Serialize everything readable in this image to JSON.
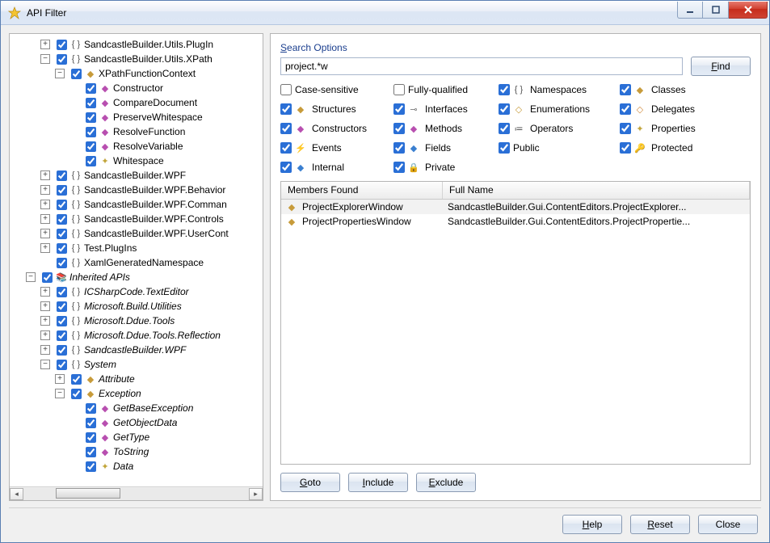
{
  "window": {
    "title": "API Filter"
  },
  "tree": [
    {
      "expand": "+",
      "chk": true,
      "kind": "ns",
      "text": "SandcastleBuilder.Utils.PlugIn",
      "indent": 0
    },
    {
      "expand": "-",
      "chk": true,
      "kind": "ns",
      "text": "SandcastleBuilder.Utils.XPath",
      "indent": 0
    },
    {
      "expand": "-",
      "chk": true,
      "kind": "cls",
      "text": "XPathFunctionContext",
      "indent": 1
    },
    {
      "expand": "",
      "chk": true,
      "kind": "mth",
      "text": "Constructor",
      "indent": 2
    },
    {
      "expand": "",
      "chk": true,
      "kind": "mth",
      "text": "CompareDocument",
      "indent": 2
    },
    {
      "expand": "",
      "chk": true,
      "kind": "mth",
      "text": "PreserveWhitespace",
      "indent": 2
    },
    {
      "expand": "",
      "chk": true,
      "kind": "mth",
      "text": "ResolveFunction",
      "indent": 2
    },
    {
      "expand": "",
      "chk": true,
      "kind": "mth",
      "text": "ResolveVariable",
      "indent": 2
    },
    {
      "expand": "",
      "chk": true,
      "kind": "prop",
      "text": "Whitespace",
      "indent": 2
    },
    {
      "expand": "+",
      "chk": true,
      "kind": "ns",
      "text": "SandcastleBuilder.WPF",
      "indent": 0
    },
    {
      "expand": "+",
      "chk": true,
      "kind": "ns",
      "text": "SandcastleBuilder.WPF.Behaviors",
      "indent": 0,
      "clip": "SandcastleBuilder.WPF.Behavior"
    },
    {
      "expand": "+",
      "chk": true,
      "kind": "ns",
      "text": "SandcastleBuilder.WPF.Commands",
      "indent": 0,
      "clip": "SandcastleBuilder.WPF.Comman"
    },
    {
      "expand": "+",
      "chk": true,
      "kind": "ns",
      "text": "SandcastleBuilder.WPF.Controls",
      "indent": 0
    },
    {
      "expand": "+",
      "chk": true,
      "kind": "ns",
      "text": "SandcastleBuilder.WPF.UserControls",
      "indent": 0,
      "clip": "SandcastleBuilder.WPF.UserCont"
    },
    {
      "expand": "+",
      "chk": true,
      "kind": "ns",
      "text": "Test.PlugIns",
      "indent": 0
    },
    {
      "expand": "",
      "chk": true,
      "kind": "ns",
      "text": "XamlGeneratedNamespace",
      "indent": 0
    },
    {
      "expand": "-",
      "chk": true,
      "kind": "root",
      "text": "Inherited APIs",
      "indent": -1,
      "italic": true
    },
    {
      "expand": "+",
      "chk": true,
      "kind": "ns",
      "text": "ICSharpCode.TextEditor",
      "indent": 0,
      "italic": true
    },
    {
      "expand": "+",
      "chk": true,
      "kind": "ns",
      "text": "Microsoft.Build.Utilities",
      "indent": 0,
      "italic": true
    },
    {
      "expand": "+",
      "chk": true,
      "kind": "ns",
      "text": "Microsoft.Ddue.Tools",
      "indent": 0,
      "italic": true
    },
    {
      "expand": "+",
      "chk": true,
      "kind": "ns",
      "text": "Microsoft.Ddue.Tools.Reflection",
      "indent": 0,
      "italic": true
    },
    {
      "expand": "+",
      "chk": true,
      "kind": "ns",
      "text": "SandcastleBuilder.WPF",
      "indent": 0,
      "italic": true
    },
    {
      "expand": "-",
      "chk": true,
      "kind": "ns",
      "text": "System",
      "indent": 0,
      "italic": true
    },
    {
      "expand": "+",
      "chk": true,
      "kind": "cls",
      "text": "Attribute",
      "indent": 1,
      "italic": true
    },
    {
      "expand": "-",
      "chk": true,
      "kind": "cls",
      "text": "Exception",
      "indent": 1,
      "italic": true
    },
    {
      "expand": "",
      "chk": true,
      "kind": "mth",
      "text": "GetBaseException",
      "indent": 2,
      "italic": true
    },
    {
      "expand": "",
      "chk": true,
      "kind": "mth",
      "text": "GetObjectData",
      "indent": 2,
      "italic": true
    },
    {
      "expand": "",
      "chk": true,
      "kind": "mth",
      "text": "GetType",
      "indent": 2,
      "italic": true
    },
    {
      "expand": "",
      "chk": true,
      "kind": "mth",
      "text": "ToString",
      "indent": 2,
      "italic": true
    },
    {
      "expand": "",
      "chk": true,
      "kind": "prop",
      "text": "Data",
      "indent": 2,
      "italic": true
    }
  ],
  "search": {
    "label": "Search Options",
    "label_ul": "S",
    "value": "project.*w",
    "find": "Find",
    "find_ul": "F"
  },
  "options": [
    {
      "checked": false,
      "icon": "",
      "label": "Case-sensitive"
    },
    {
      "checked": false,
      "icon": "",
      "label": "Fully-qualified"
    },
    {
      "checked": true,
      "icon": "ns",
      "label": "Namespaces"
    },
    {
      "checked": true,
      "icon": "cls",
      "label": "Classes"
    },
    {
      "checked": true,
      "icon": "str",
      "label": "Structures"
    },
    {
      "checked": true,
      "icon": "intf",
      "label": "Interfaces"
    },
    {
      "checked": true,
      "icon": "enm",
      "label": "Enumerations"
    },
    {
      "checked": true,
      "icon": "del",
      "label": "Delegates"
    },
    {
      "checked": true,
      "icon": "mth",
      "label": "Constructors"
    },
    {
      "checked": true,
      "icon": "mth",
      "label": "Methods"
    },
    {
      "checked": true,
      "icon": "op",
      "label": "Operators"
    },
    {
      "checked": true,
      "icon": "prop",
      "label": "Properties"
    },
    {
      "checked": true,
      "icon": "evt",
      "label": "Events"
    },
    {
      "checked": true,
      "icon": "fld",
      "label": "Fields"
    },
    {
      "checked": true,
      "icon": "",
      "label": "Public"
    },
    {
      "checked": true,
      "icon": "key",
      "label": "Protected"
    },
    {
      "checked": true,
      "icon": "fld",
      "label": "Internal"
    },
    {
      "checked": true,
      "icon": "lock",
      "label": "Private"
    }
  ],
  "results": {
    "col1": "Members Found",
    "col2": "Full Name",
    "rows": [
      {
        "name": "ProjectExplorerWindow",
        "full": "SandcastleBuilder.Gui.ContentEditors.ProjectExplorer...",
        "sel": true
      },
      {
        "name": "ProjectPropertiesWindow",
        "full": "SandcastleBuilder.Gui.ContentEditors.ProjectPropertie...",
        "sel": false
      }
    ]
  },
  "actions": {
    "goto": "Goto",
    "goto_ul": "G",
    "include": "Include",
    "include_ul": "I",
    "exclude": "Exclude",
    "exclude_ul": "E"
  },
  "footer": {
    "help": "Help",
    "help_ul": "H",
    "reset": "Reset",
    "reset_ul": "R",
    "close": "Close"
  },
  "icons": {
    "ns": "{ }",
    "cls": "◆",
    "mth": "◆",
    "prop": "✦",
    "fld": "◆",
    "evt": "⚡",
    "str": "◆",
    "del": "◇",
    "enm": "◇",
    "intf": "⊸",
    "op": "≔",
    "root": "📚",
    "key": "🔑",
    "lock": "🔒"
  }
}
